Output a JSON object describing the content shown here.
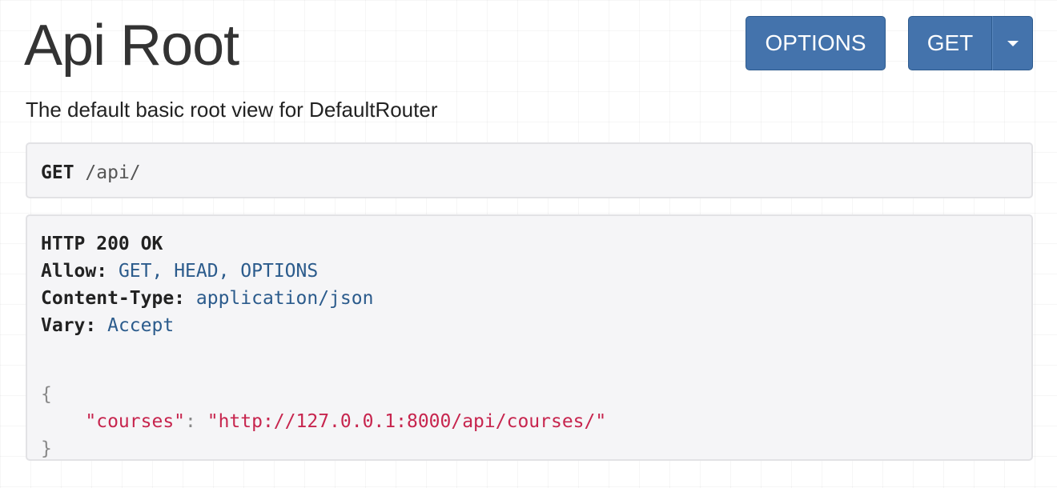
{
  "page": {
    "title": "Api Root",
    "description": "The default basic root view for DefaultRouter"
  },
  "toolbar": {
    "options_label": "OPTIONS",
    "get_label": "GET"
  },
  "request": {
    "method": "GET",
    "path": "/api/"
  },
  "response": {
    "status": "HTTP 200 OK",
    "headers": [
      {
        "name": "Allow:",
        "value": "GET, HEAD, OPTIONS"
      },
      {
        "name": "Content-Type:",
        "value": "application/json"
      },
      {
        "name": "Vary:",
        "value": "Accept"
      }
    ],
    "body": {
      "open_brace": "{",
      "key": "\"courses\"",
      "colon": ": ",
      "value": "\"http://127.0.0.1:8000/api/courses/\"",
      "close_brace": "}"
    }
  },
  "colors": {
    "button": "#4473ac",
    "header_value": "#2b5b8c",
    "json_string": "#c7254e"
  }
}
